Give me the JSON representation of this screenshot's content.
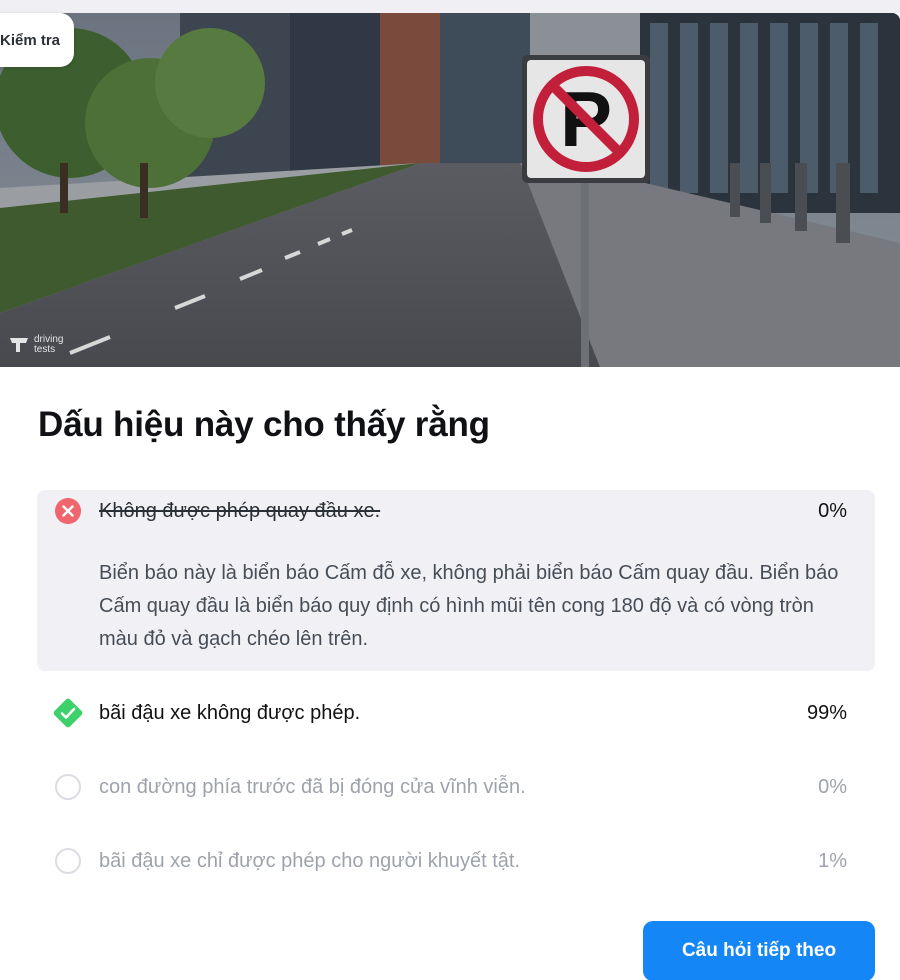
{
  "header": {
    "check_pill_label": "Kiểm tra",
    "watermark_brand": "driving tests"
  },
  "question": {
    "title": "Dấu hiệu này cho thấy rằng"
  },
  "answers": [
    {
      "label": "Không được phép quay đầu xe.",
      "percent": "0%",
      "status": "incorrect",
      "explanation": "Biển báo này là biển báo Cấm đỗ xe, không phải biển báo Cấm quay đầu. Biển báo Cấm quay đầu là biển báo quy định có hình mũi tên cong 180 độ và có vòng tròn màu đỏ và gạch chéo lên trên."
    },
    {
      "label": "bãi đậu xe không được phép.",
      "percent": "99%",
      "status": "correct"
    },
    {
      "label": "con đường phía trước đã bị đóng cửa vĩnh viễn.",
      "percent": "0%",
      "status": "unselected"
    },
    {
      "label": "bãi đậu xe chỉ được phép cho người khuyết tật.",
      "percent": "1%",
      "status": "unselected"
    }
  ],
  "footer": {
    "next_button_label": "Câu hỏi tiếp theo"
  },
  "colors": {
    "accent": "#1486f5",
    "incorrect": "#f0666e",
    "correct": "#3ed06b",
    "answer_highlight_bg": "#f1f1f5"
  }
}
